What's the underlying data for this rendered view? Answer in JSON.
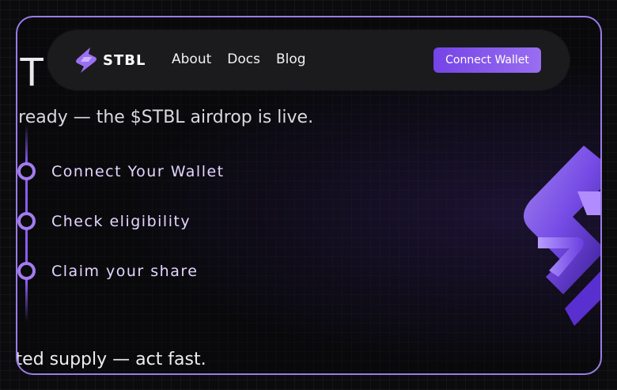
{
  "hero": {
    "title_fragment": "ST",
    "subtitle": "et ready — the $STBL airdrop is live.",
    "bottom_text": "mited supply — act fast."
  },
  "steps": [
    {
      "label": "Connect Your Wallet"
    },
    {
      "label": "Check eligibility"
    },
    {
      "label": "Claim your share"
    }
  ],
  "navbar": {
    "logo_text": "STBL",
    "links": [
      "About",
      "Docs",
      "Blog"
    ],
    "cta_label": "Connect Wallet"
  },
  "colors": {
    "accent": "#8b5cf6",
    "border": "#9b7bea",
    "background": "#0b0b0d"
  },
  "icons": {
    "logo": "stbl-bolt-icon",
    "hero_art": "3d-bolt-logo-icon"
  }
}
